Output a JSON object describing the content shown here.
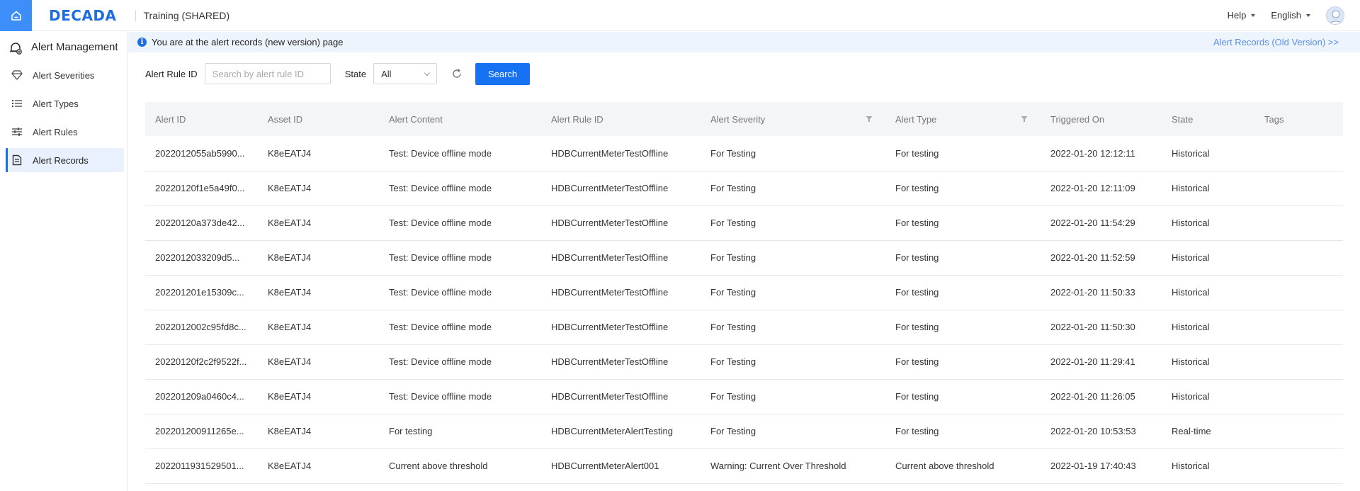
{
  "header": {
    "logo": "DECADA",
    "org": "Training (SHARED)",
    "help": "Help",
    "language": "English"
  },
  "sidebar": {
    "title": "Alert Management",
    "items": [
      {
        "label": "Alert Severities",
        "icon": "diamond-icon"
      },
      {
        "label": "Alert Types",
        "icon": "list-icon"
      },
      {
        "label": "Alert Rules",
        "icon": "sliders-icon"
      },
      {
        "label": "Alert Records",
        "icon": "document-icon",
        "active": true
      }
    ]
  },
  "notice": {
    "text": "You are at the alert records (new version) page",
    "link": "Alert Records (Old Version) >>"
  },
  "filters": {
    "rule_label": "Alert Rule ID",
    "rule_placeholder": "Search by alert rule ID",
    "state_label": "State",
    "state_value": "All",
    "search_label": "Search"
  },
  "table": {
    "columns": [
      "Alert ID",
      "Asset ID",
      "Alert Content",
      "Alert Rule ID",
      "Alert Severity",
      "Alert Type",
      "Triggered On",
      "State",
      "Tags"
    ],
    "rows": [
      [
        "2022012055ab5990...",
        "K8eEATJ4",
        "Test: Device offline mode",
        "HDBCurrentMeterTestOffline",
        "For Testing",
        "For testing",
        "2022-01-20 12:12:11",
        "Historical",
        ""
      ],
      [
        "20220120f1e5a49f0...",
        "K8eEATJ4",
        "Test: Device offline mode",
        "HDBCurrentMeterTestOffline",
        "For Testing",
        "For testing",
        "2022-01-20 12:11:09",
        "Historical",
        ""
      ],
      [
        "20220120a373de42...",
        "K8eEATJ4",
        "Test: Device offline mode",
        "HDBCurrentMeterTestOffline",
        "For Testing",
        "For testing",
        "2022-01-20 11:54:29",
        "Historical",
        ""
      ],
      [
        "2022012033209d5...",
        "K8eEATJ4",
        "Test: Device offline mode",
        "HDBCurrentMeterTestOffline",
        "For Testing",
        "For testing",
        "2022-01-20 11:52:59",
        "Historical",
        ""
      ],
      [
        "202201201e15309c...",
        "K8eEATJ4",
        "Test: Device offline mode",
        "HDBCurrentMeterTestOffline",
        "For Testing",
        "For testing",
        "2022-01-20 11:50:33",
        "Historical",
        ""
      ],
      [
        "2022012002c95fd8c...",
        "K8eEATJ4",
        "Test: Device offline mode",
        "HDBCurrentMeterTestOffline",
        "For Testing",
        "For testing",
        "2022-01-20 11:50:30",
        "Historical",
        ""
      ],
      [
        "20220120f2c2f9522f...",
        "K8eEATJ4",
        "Test: Device offline mode",
        "HDBCurrentMeterTestOffline",
        "For Testing",
        "For testing",
        "2022-01-20 11:29:41",
        "Historical",
        ""
      ],
      [
        "202201209a0460c4...",
        "K8eEATJ4",
        "Test: Device offline mode",
        "HDBCurrentMeterTestOffline",
        "For Testing",
        "For testing",
        "2022-01-20 11:26:05",
        "Historical",
        ""
      ],
      [
        "202201200911265e...",
        "K8eEATJ4",
        "For testing",
        "HDBCurrentMeterAlertTesting",
        "For Testing",
        "For testing",
        "2022-01-20 10:53:53",
        "Real-time",
        ""
      ],
      [
        "2022011931529501...",
        "K8eEATJ4",
        "Current above threshold",
        "HDBCurrentMeterAlert001",
        "Warning: Current Over Threshold",
        "Current above threshold",
        "2022-01-19 17:40:43",
        "Historical",
        ""
      ]
    ]
  }
}
